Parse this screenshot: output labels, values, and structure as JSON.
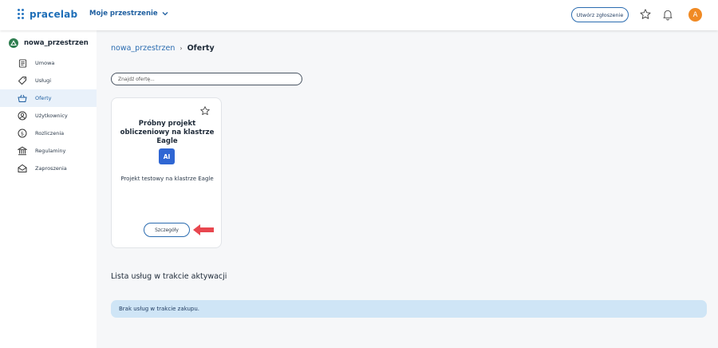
{
  "header": {
    "logo_text": "pracelab",
    "space_switch_label": "Moje przestrzenie",
    "create_ticket_label": "Utwórz zgłoszenie",
    "avatar_initial": "A",
    "avatar_color": "#f08a24"
  },
  "sidebar": {
    "workspace_name": "nowa_przestrzen",
    "items": [
      {
        "label": "Umowa",
        "icon": "document-icon"
      },
      {
        "label": "Usługi",
        "icon": "tag-icon"
      },
      {
        "label": "Oferty",
        "icon": "basket-icon",
        "active": true
      },
      {
        "label": "Użytkownicy",
        "icon": "user-circle-icon"
      },
      {
        "label": "Rozliczenia",
        "icon": "dollar-circle-icon"
      },
      {
        "label": "Regulaminy",
        "icon": "bank-icon"
      },
      {
        "label": "Zaproszenia",
        "icon": "envelope-open-icon"
      }
    ]
  },
  "breadcrumb": {
    "parent": "nowa_przestrzen",
    "current": "Oferty"
  },
  "search": {
    "placeholder": "Znajdź ofertę..."
  },
  "offer_card": {
    "title": "Próbny projekt obliczeniowy na klastrze Eagle",
    "badge": "AI",
    "description": "Projekt testowy na klastrze Eagle",
    "details_label": "Szczegóły"
  },
  "activation_section": {
    "title": "Lista usług w trakcie aktywacji",
    "empty_message": "Brak usług w trakcie zakupu."
  },
  "colors": {
    "accent": "#2b6cb0",
    "active_nav_bg": "#e9f1fa",
    "info_bar_bg": "#cfe5f6",
    "arrow": "#e8474f"
  }
}
